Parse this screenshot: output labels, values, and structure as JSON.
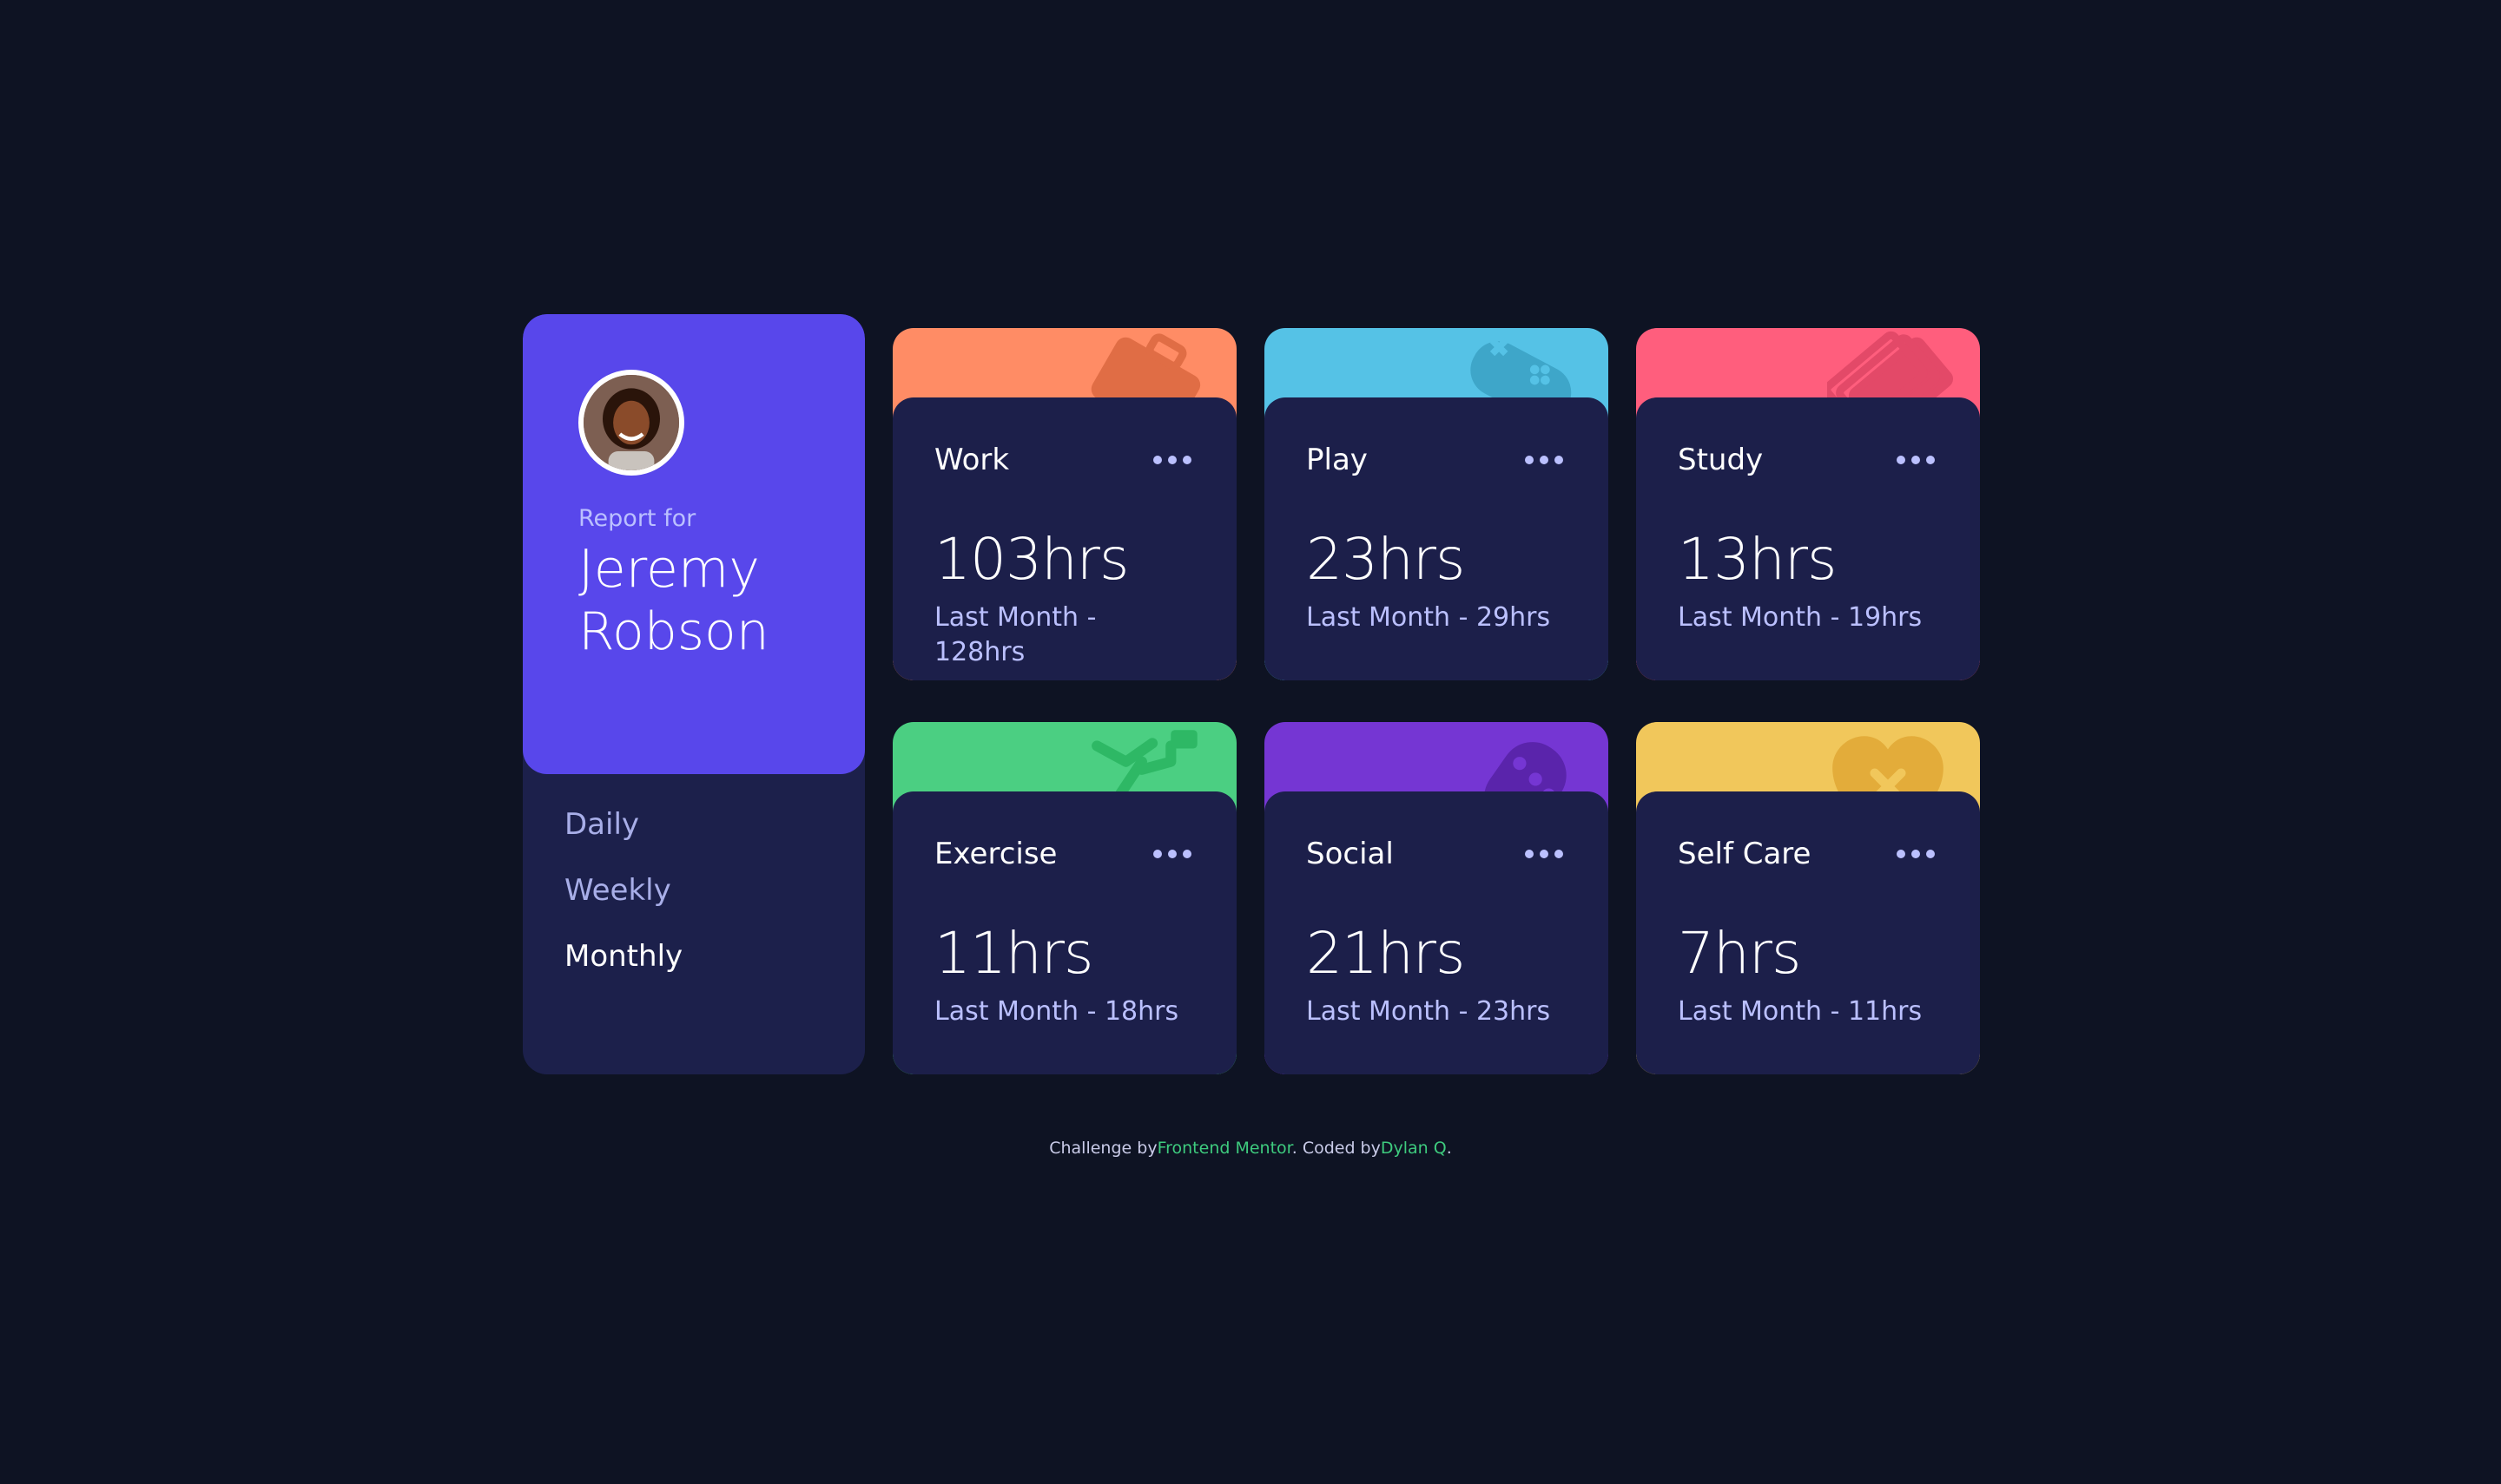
{
  "profile": {
    "report_for": "Report for",
    "name_line1": "Jeremy",
    "name_line2": "Robson"
  },
  "periods": [
    "Daily",
    "Weekly",
    "Monthly"
  ],
  "active_period": "Monthly",
  "cards": [
    {
      "title": "Work",
      "current": "103hrs",
      "previous": "Last Month - 128hrs",
      "color": "#ff8c65",
      "icon": "briefcase-icon"
    },
    {
      "title": "Play",
      "current": "23hrs",
      "previous": "Last Month - 29hrs",
      "color": "#55c2e6",
      "icon": "gamepad-icon"
    },
    {
      "title": "Study",
      "current": "13hrs",
      "previous": "Last Month - 19hrs",
      "color": "#ff5e7d",
      "icon": "books-icon"
    },
    {
      "title": "Exercise",
      "current": "11hrs",
      "previous": "Last Month - 18hrs",
      "color": "#4bcf82",
      "icon": "runner-icon"
    },
    {
      "title": "Social",
      "current": "21hrs",
      "previous": "Last Month - 23hrs",
      "color": "#7536d3",
      "icon": "social-icon"
    },
    {
      "title": "Self Care",
      "current": "7hrs",
      "previous": "Last Month - 11hrs",
      "color": "#f1c75b",
      "icon": "heart-icon"
    }
  ],
  "footer": {
    "prefix": "Challenge by",
    "link1": "Frontend Mentor",
    "middle": ". Coded by",
    "link2": "Dylan Q",
    "suffix": "."
  },
  "colors": {
    "background": "#0e1323",
    "card": "#1c1f4a",
    "profile_accent": "#5847eb",
    "muted_text": "#bbc0ff",
    "link": "#3ecb7e"
  }
}
